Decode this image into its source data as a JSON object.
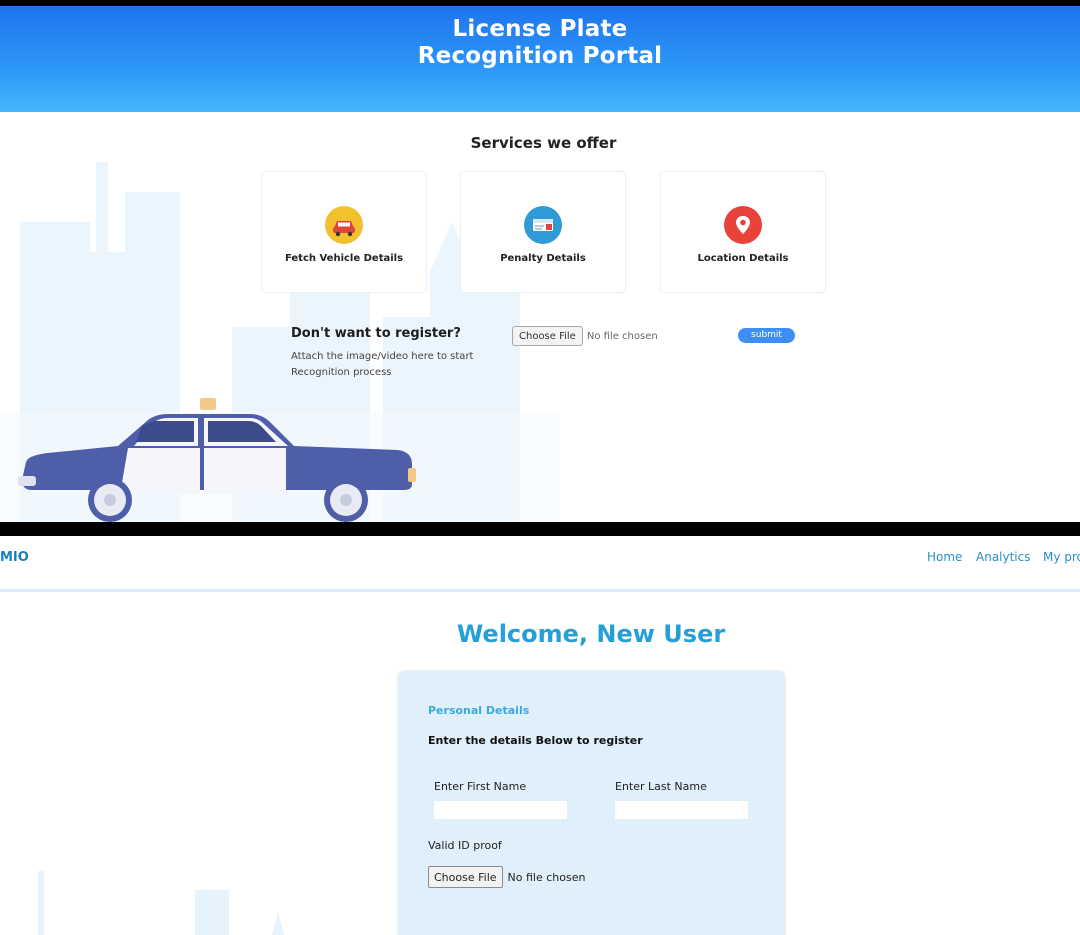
{
  "portal": {
    "title_line1": "License Plate",
    "title_line2": "Recognition Portal",
    "services_heading": "Services we offer",
    "services": [
      {
        "label": "Fetch Vehicle Details",
        "icon": "taxi-icon",
        "color": "#f2c12e"
      },
      {
        "label": "Penalty Details",
        "icon": "ticket-icon",
        "color": "#2f9ad6"
      },
      {
        "label": "Location Details",
        "icon": "location-pin-icon",
        "color": "#e8423b"
      }
    ],
    "register_question": "Don't want to register?",
    "register_description": "Attach the image/video here to start Recognition process",
    "choose_file_label": "Choose File",
    "no_file_text": "No file chosen",
    "submit_label": "submit"
  },
  "registration": {
    "brand": "MIO",
    "nav": {
      "home": "Home",
      "analytics": "Analytics",
      "my_profile": "My pro"
    },
    "welcome": "Welcome, New User",
    "section_title": "Personal Details",
    "instruction": "Enter the details Below to register",
    "first_name_label": "Enter First Name",
    "first_name_value": "",
    "last_name_label": "Enter Last Name",
    "last_name_value": "",
    "id_proof_label": "Valid ID proof",
    "choose_file_label": "Choose File",
    "no_file_text": "No file chosen"
  },
  "colors": {
    "hero_blue": "#2b95f6",
    "accent_blue": "#25a0d6",
    "submit_blue": "#3e8ef6",
    "card_bg": "#dff0fb",
    "taxi_body": "#4e5ea8"
  }
}
